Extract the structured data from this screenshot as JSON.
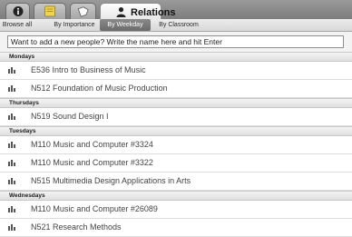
{
  "tabs": [
    {
      "name": "info",
      "icon": "info-icon",
      "label": ""
    },
    {
      "name": "notes",
      "icon": "note-icon",
      "label": ""
    },
    {
      "name": "tags",
      "icon": "tag-icon",
      "label": ""
    },
    {
      "name": "relations",
      "icon": "person-icon",
      "label": "Relations"
    }
  ],
  "subnav": {
    "browse_all": "Browse all",
    "by_importance": "By Importance",
    "by_weekday": "By Weekday",
    "by_classroom": "By Classroom"
  },
  "new_person": {
    "placeholder": "Want to add a new people? Write the name here and hit Enter"
  },
  "groups": [
    {
      "day": "Mondays",
      "items": [
        "E536 Intro to Business of Music",
        "N512 Foundation of Music Production"
      ]
    },
    {
      "day": "Thursdays",
      "items": [
        "N519 Sound Design I"
      ]
    },
    {
      "day": "Tuesdays",
      "items": [
        "M110 Music and Computer #3324",
        "M110 Music and Computer #3322",
        "N515 Multimedia Design Applications in Arts"
      ]
    },
    {
      "day": "Wednesdays",
      "items": [
        "M110 Music and Computer #26089",
        "N521 Research Methods"
      ]
    }
  ]
}
